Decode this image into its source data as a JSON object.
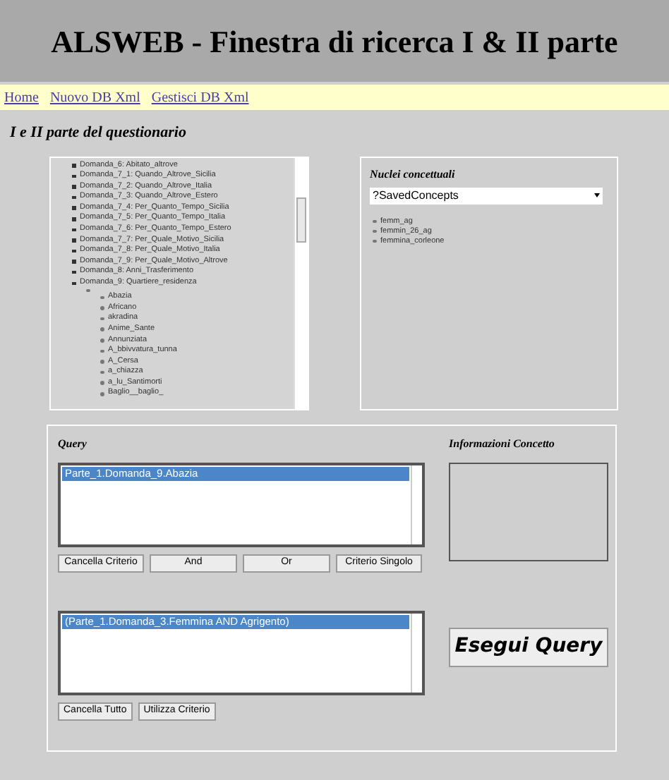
{
  "header": {
    "title": "ALSWEB - Finestra di ricerca I & II parte"
  },
  "nav": [
    "Home",
    "Nuovo DB Xml",
    "Gestisci DB Xml"
  ],
  "section_title": "I e II parte del questionario",
  "tree": [
    {
      "label": "Domanda_6: Abitato_altrove"
    },
    {
      "label": "Domanda_7_1: Quando_Altrove_Sicilia"
    },
    {
      "label": "Domanda_7_2: Quando_Altrove_Italia"
    },
    {
      "label": "Domanda_7_3: Quando_Altrove_Estero"
    },
    {
      "label": "Domanda_7_4: Per_Quanto_Tempo_Sicilia"
    },
    {
      "label": "Domanda_7_5: Per_Quanto_Tempo_Italia"
    },
    {
      "label": "Domanda_7_6: Per_Quanto_Tempo_Estero"
    },
    {
      "label": "Domanda_7_7: Per_Quale_Motivo_Sicilia"
    },
    {
      "label": "Domanda_7_8: Per_Quale_Motivo_Italia"
    },
    {
      "label": "Domanda_7_9: Per_Quale_Motivo_Altrove"
    },
    {
      "label": "Domanda_8: Anni_Trasferimento"
    },
    {
      "label": "Domanda_9: Quartiere_residenza",
      "children": [
        {
          "children": [
            {
              "label": "Abazia"
            },
            {
              "label": "Africano"
            },
            {
              "label": "akradina"
            },
            {
              "label": "Anime_Sante"
            },
            {
              "label": "Annunziata"
            },
            {
              "label": "A_bbivvatura_tunna"
            },
            {
              "label": "A_Cersa"
            },
            {
              "label": "a_chiazza"
            },
            {
              "label": "a_lu_Santimorti"
            },
            {
              "label": "Baglio__baglio_"
            }
          ]
        }
      ]
    }
  ],
  "concepts": {
    "title": "Nuclei concettuali",
    "select": "?SavedConcepts",
    "items": [
      "femm_ag",
      "femmin_26_ag",
      "femmina_corleone"
    ]
  },
  "query": {
    "title": "Query",
    "list": [
      {
        "label": "Parte_1.Domanda_9.Abazia",
        "selected": true
      }
    ],
    "buttons": [
      "Cancella Criterio",
      "And",
      "Or",
      "Criterio Singolo"
    ]
  },
  "info": {
    "title": "Informazioni Concetto"
  },
  "criteria": {
    "list": [
      {
        "label": "(Parte_1.Domanda_3.Femmina AND Agrigento)",
        "selected": true
      }
    ],
    "buttons": [
      "Cancella Tutto",
      "Utilizza Criterio"
    ]
  },
  "run_button": "Esegui Query"
}
